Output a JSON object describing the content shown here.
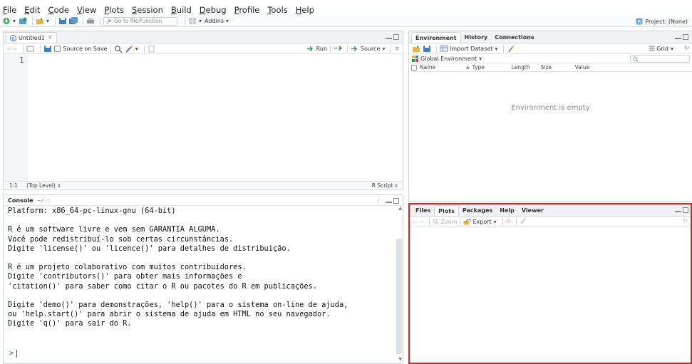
{
  "menubar": {
    "items": [
      "File",
      "Edit",
      "Code",
      "View",
      "Plots",
      "Session",
      "Build",
      "Debug",
      "Profile",
      "Tools",
      "Help"
    ],
    "underline": [
      "F",
      "E",
      "C",
      "V",
      "P",
      "S",
      "B",
      "D",
      "P",
      "T",
      "H"
    ]
  },
  "toolbar": {
    "goto_placeholder": "Go to file/function",
    "addins_label": "Addins",
    "project_label": "Project: (None)"
  },
  "source": {
    "tab_label": "Untitled1",
    "tab_close": "×",
    "source_on_save_label": "Source on Save",
    "run_label": "Run",
    "source_label": "Source",
    "line_number": "1",
    "cursor_pos": "1:1",
    "scope": "(Top Level)",
    "file_type": "R Script"
  },
  "console": {
    "tab_label": "Console",
    "path": "~/",
    "lines": [
      "Platform: x86_64-pc-linux-gnu (64-bit)",
      "",
      "R é um software livre e vem sem GARANTIA ALGUMA.",
      "Você pode redistribuí-lo sob certas circunstâncias.",
      "Digite 'license()' ou 'licence()' para detalhes de distribuição.",
      "",
      "R é um projeto colaborativo com muitos contribuidores.",
      "Digite 'contributors()' para obter mais informações e",
      "'citation()' para saber como citar o R ou pacotes do R em publicações.",
      "",
      "Digite 'demo()' para demonstrações, 'help()' para o sistema on-line de ajuda,",
      "ou 'help.start()' para abrir o sistema de ajuda em HTML no seu navegador.",
      "Digite 'q()' para sair do R.",
      ""
    ],
    "prompt": ">"
  },
  "environment": {
    "tabs": [
      "Environment",
      "History",
      "Connections"
    ],
    "import_label": "Import Dataset",
    "grid_label": "Grid",
    "scope_label": "Global Environment",
    "columns": [
      "Name",
      "Type",
      "Length",
      "Size",
      "Value"
    ],
    "empty_message": "Environment is empty"
  },
  "files": {
    "tabs": [
      "Files",
      "Plots",
      "Packages",
      "Help",
      "Viewer"
    ],
    "active_tab": "Plots",
    "zoom_label": "Zoom",
    "export_label": "Export"
  },
  "colors": {
    "accent": "#4a88c7",
    "highlight_border": "#e02020",
    "green_plus": "#2e9e3e"
  }
}
